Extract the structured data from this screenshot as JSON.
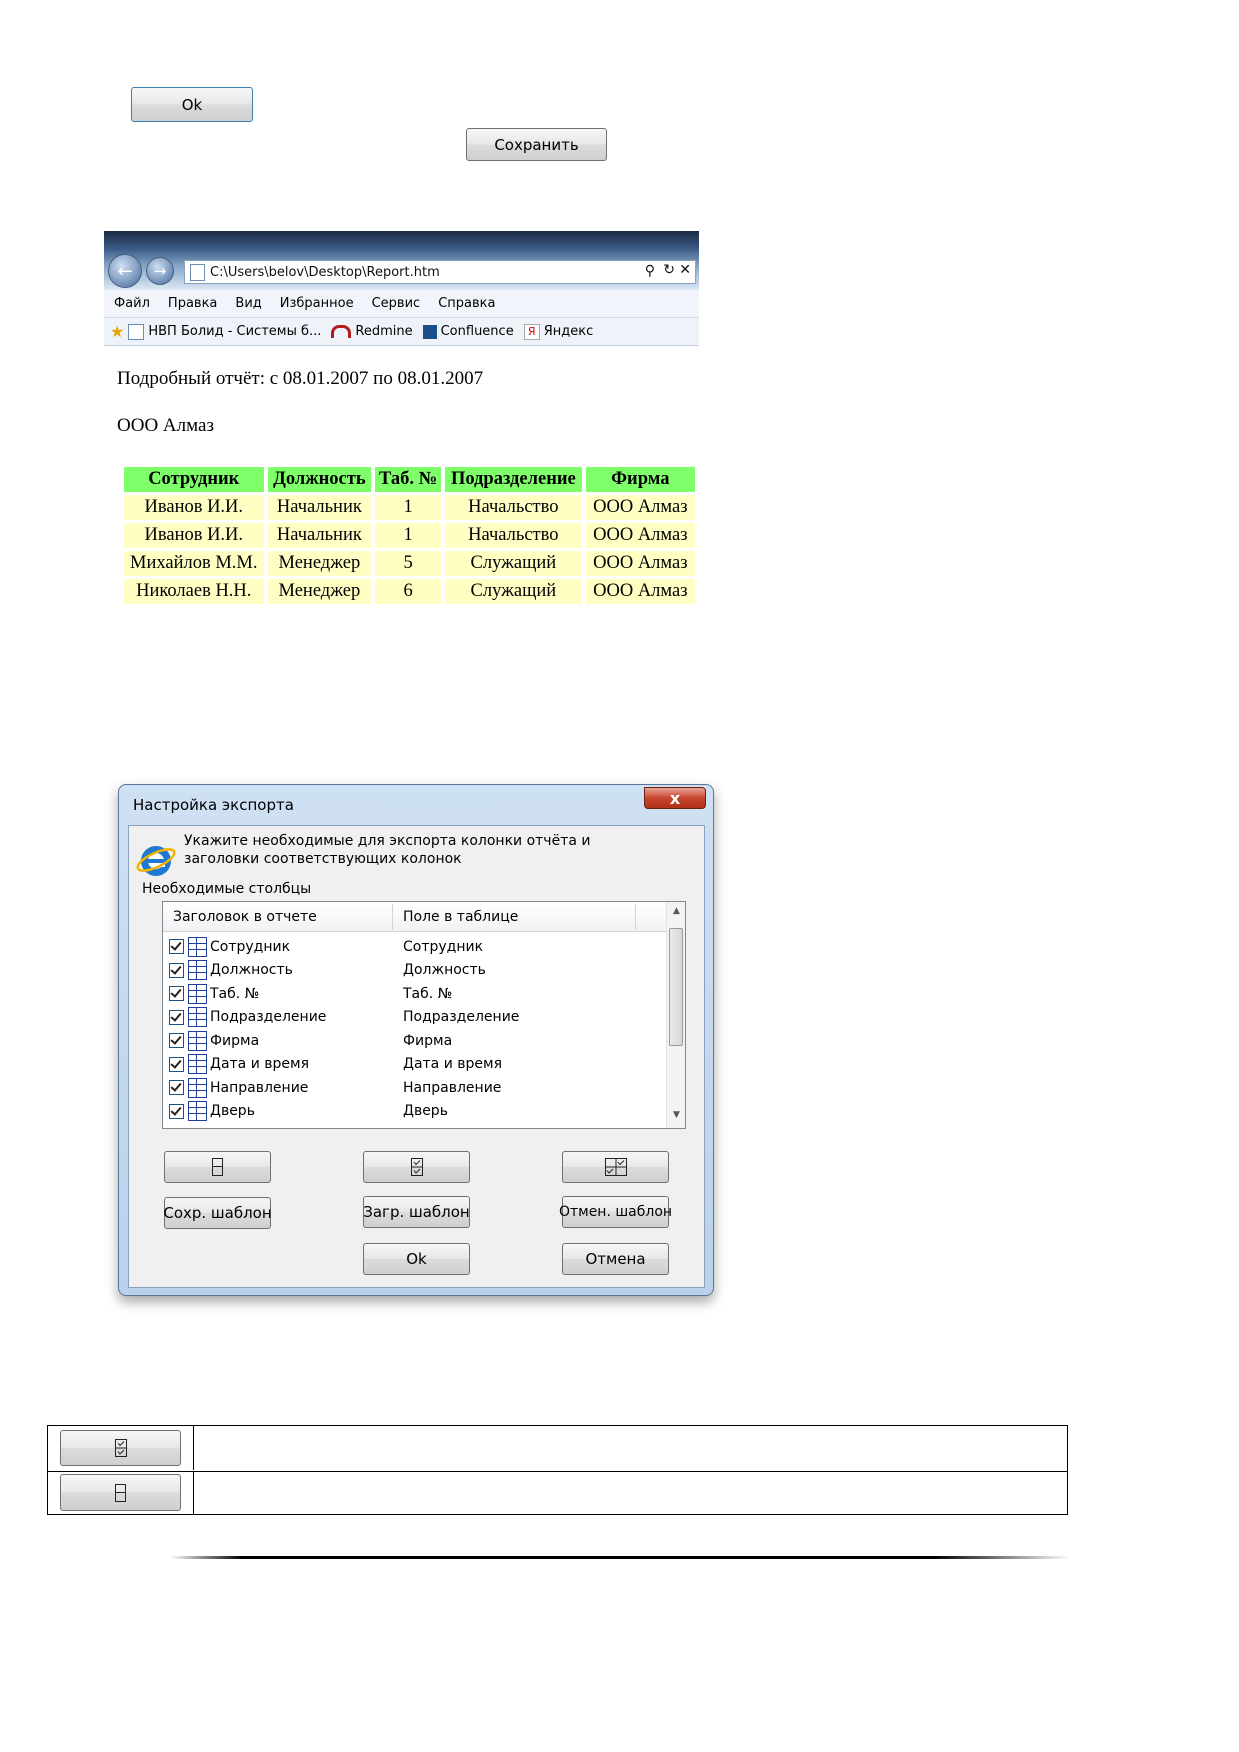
{
  "top_buttons": {
    "ok_label": "Ok",
    "save_label": "Сохранить"
  },
  "ie_window": {
    "address": "C:\\Users\\belov\\Desktop\\Report.htm",
    "menu": [
      "Файл",
      "Правка",
      "Вид",
      "Избранное",
      "Сервис",
      "Справка"
    ],
    "favorites": [
      "НВП Болид - Системы б...",
      "Redmine",
      "Confluence",
      "Яндекс"
    ],
    "report": {
      "title": "Подробный отчёт: с 08.01.2007 по 08.01.2007",
      "org": "ООО Алмаз",
      "columns": [
        "Сотрудник",
        "Должность",
        "Таб. №",
        "Подразделение",
        "Фирма"
      ],
      "rows": [
        [
          "Иванов И.И.",
          "Начальник",
          "1",
          "Начальство",
          "ООО Алмаз"
        ],
        [
          "Иванов И.И.",
          "Начальник",
          "1",
          "Начальство",
          "ООО Алмаз"
        ],
        [
          "Михайлов М.М.",
          "Менеджер",
          "5",
          "Служащий",
          "ООО Алмаз"
        ],
        [
          "Николаев Н.Н.",
          "Менеджер",
          "6",
          "Служащий",
          "ООО Алмаз"
        ]
      ]
    }
  },
  "export_dialog": {
    "title": "Настройка экспорта",
    "close_glyph": "x",
    "description": "Укажите необходимые для экспорта колонки отчёта и заголовки соответствующих колонок",
    "section_label": "Необходимые столбцы",
    "list_headers": [
      "Заголовок в отчете",
      "Поле в таблице"
    ],
    "list_items": [
      {
        "header": "Сотрудник",
        "field": "Сотрудник"
      },
      {
        "header": "Должность",
        "field": "Должность"
      },
      {
        "header": "Таб. №",
        "field": "Таб. №"
      },
      {
        "header": "Подразделение",
        "field": "Подразделение"
      },
      {
        "header": "Фирма",
        "field": "Фирма"
      },
      {
        "header": "Дата и время",
        "field": "Дата и время"
      },
      {
        "header": "Направление",
        "field": "Направление"
      },
      {
        "header": "Дверь",
        "field": "Дверь"
      }
    ],
    "buttons": {
      "save_template": "Сохр. шаблон",
      "load_template": "Загр. шаблон",
      "cancel_template": "Отмен. шаблон",
      "ok": "Ok",
      "cancel": "Отмена"
    }
  }
}
